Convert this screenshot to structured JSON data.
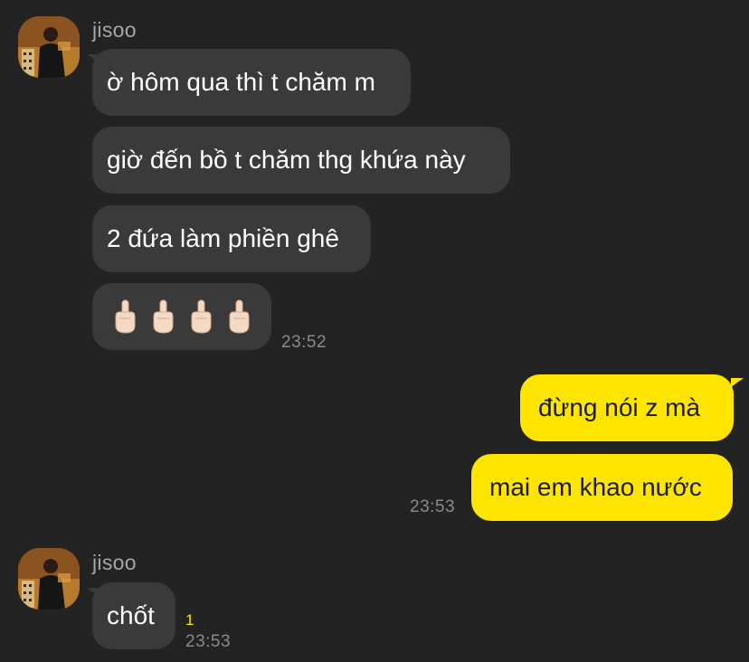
{
  "conversation": {
    "block1": {
      "sender": "jisoo",
      "messages": [
        "ờ hôm qua thì t chăm m",
        "giờ đến bồ t chăm thg khứa này",
        "2 đứa làm phiền ghê"
      ],
      "emoji_count": 4,
      "time": "23:52"
    },
    "block2": {
      "messages": [
        "đừng nói z mà",
        "mai em khao nước"
      ],
      "time": "23:53"
    },
    "block3": {
      "sender": "jisoo",
      "message": "chốt",
      "unread": "1",
      "time": "23:53"
    }
  },
  "colors": {
    "background": "#232323",
    "incoming_bubble": "#3a3a3a",
    "outgoing_bubble": "#fee500",
    "timestamp": "#8a8a8a"
  },
  "icons": {
    "emoji": "middle-finger-emoji",
    "avatar": "profile-photo"
  }
}
